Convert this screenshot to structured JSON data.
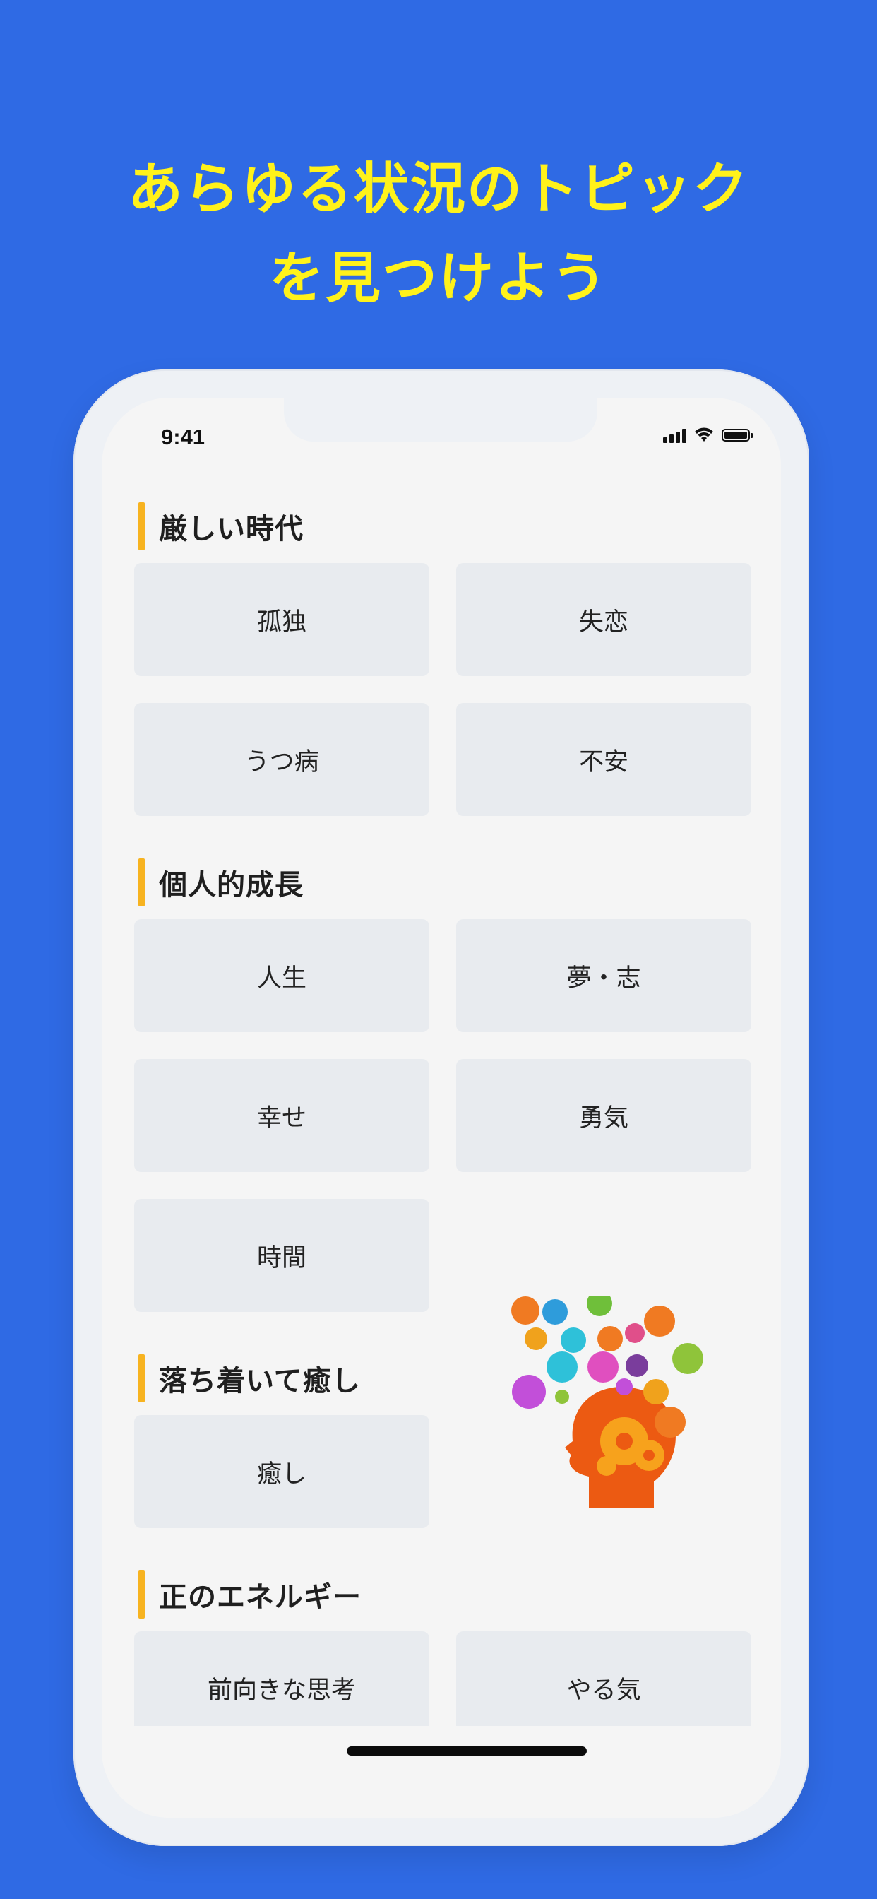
{
  "headline": {
    "line1": "あらゆる状況のトピック",
    "line2": "を見つけよう"
  },
  "status_bar": {
    "time": "9:41"
  },
  "sections": [
    {
      "title": "厳しい時代",
      "items": [
        "孤独",
        "失恋",
        "うつ病",
        "不安"
      ]
    },
    {
      "title": "個人的成長",
      "items": [
        "人生",
        "夢・志",
        "幸せ",
        "勇気",
        "時間"
      ]
    },
    {
      "title": "落ち着いて癒し",
      "items": [
        "癒し"
      ]
    },
    {
      "title": "正のエネルギー",
      "items": [
        "前向きな思考",
        "やる気"
      ]
    }
  ],
  "colors": {
    "background": "#2f6ae4",
    "headline": "#fff21a",
    "accent_bar": "#f7b320",
    "tile": "#e8ebef"
  },
  "icons": [
    "head-gears-illustration"
  ]
}
